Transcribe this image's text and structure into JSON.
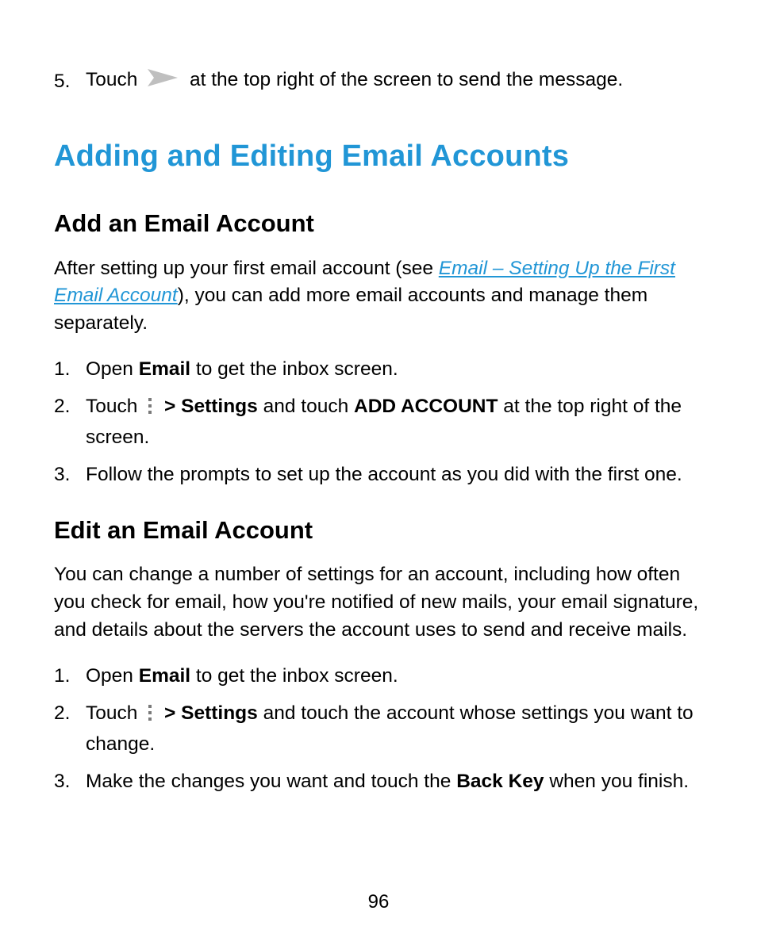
{
  "send_step": {
    "num": "5.",
    "before": "Touch",
    "after": " at the top right of the screen to send the message."
  },
  "h1": "Adding and Editing Email Accounts",
  "add": {
    "h2": "Add an Email Account",
    "intro_before": "After setting up your first email account (see ",
    "intro_link": "Email – Setting Up the First Email Account",
    "intro_after": "), you can add more email accounts and manage them separately.",
    "step1": {
      "num": "1.",
      "before": "Open ",
      "bold": "Email",
      "after": " to get the inbox screen."
    },
    "step2": {
      "num": "2.",
      "before": "Touch ",
      "mid1": " ",
      "bold1": "> Settings",
      "mid2": " and touch ",
      "bold2": "ADD ACCOUNT",
      "after": " at the top right of the screen."
    },
    "step3": {
      "num": "3.",
      "text": "Follow the prompts to set up the account as you did with the first one."
    }
  },
  "edit": {
    "h2": "Edit an Email Account",
    "intro": "You can change a number of settings for an account, including how often you check for email, how you're notified of new mails, your email signature, and details about the servers the account uses to send and receive mails.",
    "step1": {
      "num": "1.",
      "before": "Open ",
      "bold": "Email",
      "after": " to get the inbox screen."
    },
    "step2": {
      "num": "2.",
      "before": "Touch ",
      "mid1": " ",
      "bold1": "> Settings",
      "after": " and touch the account whose settings you want to change."
    },
    "step3": {
      "num": "3.",
      "before": "Make the changes you want and touch the ",
      "bold": "Back Key",
      "after": " when you finish."
    }
  },
  "pagenum": "96"
}
